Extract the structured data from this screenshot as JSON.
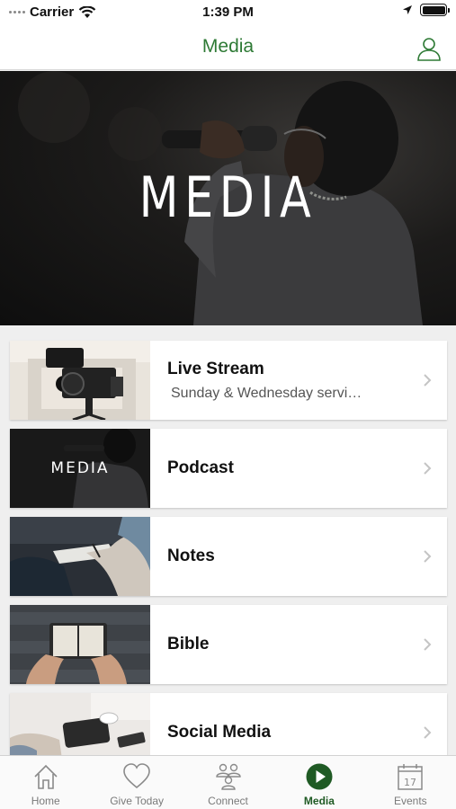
{
  "status_bar": {
    "carrier": "Carrier",
    "time": "1:39 PM"
  },
  "nav": {
    "title": "Media",
    "profile_icon": "person-icon",
    "accent": "#2e7a35"
  },
  "hero": {
    "title": "MEDIA"
  },
  "items": [
    {
      "title": "Live Stream",
      "subtitle": "Sunday  & Wednesday servi…"
    },
    {
      "title": "Podcast",
      "thumb_text": "MEDIA"
    },
    {
      "title": "Notes"
    },
    {
      "title": "Bible"
    },
    {
      "title": "Social Media"
    }
  ],
  "tabs": [
    {
      "label": "Home",
      "icon": "home-icon"
    },
    {
      "label": "Give Today",
      "icon": "heart-icon"
    },
    {
      "label": "Connect",
      "icon": "people-icon"
    },
    {
      "label": "Media",
      "icon": "play-icon",
      "active": true
    },
    {
      "label": "Events",
      "icon": "calendar-icon",
      "day": "17"
    }
  ]
}
